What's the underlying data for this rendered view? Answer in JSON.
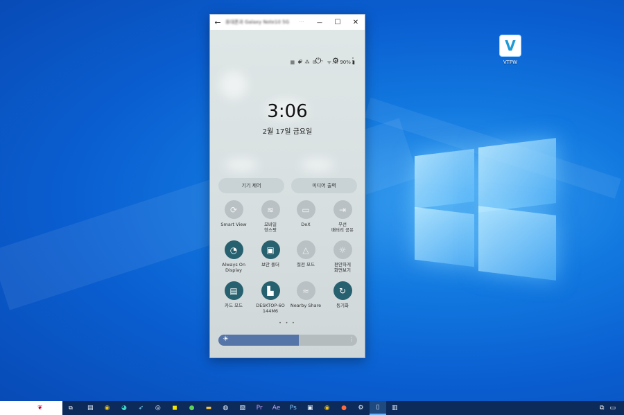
{
  "desktop": {
    "icon_label": "VTPW",
    "icon_glyph": "V"
  },
  "window": {
    "title": "휴대폰과 Galaxy Note10 5G",
    "back_glyph": "←",
    "minimize_glyph": "—",
    "maximize_glyph": "☐",
    "close_glyph": "✕",
    "more_glyph": "···"
  },
  "phone": {
    "status_icons": "▦ ✱ ⁂ ✉ ⌔ ᯤ.ıl",
    "battery": "90%",
    "battery_glyph": "▮",
    "actions": {
      "search": "⌕",
      "power": "⏻",
      "settings": "⚙",
      "more": "⋮"
    },
    "clock": "3:06",
    "date": "2월 17일 금요일",
    "device_control": "기기 제어",
    "media_output": "미디어 출력",
    "tiles": [
      {
        "label": "Smart View",
        "glyph": "⟳",
        "active": false
      },
      {
        "label": "모바일\n핫스팟",
        "glyph": "≋",
        "active": false
      },
      {
        "label": "DeX",
        "glyph": "▭",
        "active": false
      },
      {
        "label": "무선\n배터리 공유",
        "glyph": "⇥",
        "active": false
      },
      {
        "label": "Always On\nDisplay",
        "glyph": "◔",
        "active": true
      },
      {
        "label": "보안 폴더",
        "glyph": "▣",
        "active": true
      },
      {
        "label": "절전 모드",
        "glyph": "△",
        "active": false
      },
      {
        "label": "편안하게\n화면보기",
        "glyph": "☼",
        "active": false
      },
      {
        "label": "카드 모드",
        "glyph": "▤",
        "active": true
      },
      {
        "label": "DESKTOP-6O\n144M6",
        "glyph": "▙",
        "active": true
      },
      {
        "label": "Nearby Share",
        "glyph": "≈",
        "active": false
      },
      {
        "label": "동기화",
        "glyph": "↻",
        "active": true
      }
    ],
    "page_dots": "• • •",
    "brightness": {
      "level": 0.58,
      "sun_glyph": "☀",
      "more_glyph": "⋮"
    },
    "nav": {
      "recents": "|||",
      "home": "○",
      "back": "<"
    }
  },
  "taskbar": {
    "tray_glyphs": [
      "⧉",
      "▭"
    ]
  }
}
